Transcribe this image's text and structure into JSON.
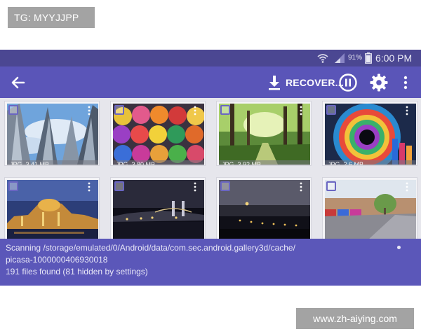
{
  "watermarks": {
    "top": "TG: MYYJJPP",
    "bottom": "www.zh-aiying.com"
  },
  "status_bar": {
    "battery_percent": "91%",
    "time": "6:00 PM"
  },
  "toolbar": {
    "back_icon": "arrow-left-icon",
    "recover_label": "RECOVER...",
    "recover_icon": "download-icon",
    "pause_icon": "pause-circle-icon",
    "settings_icon": "gear-icon",
    "more_icon": "more-vert-icon"
  },
  "photos": [
    {
      "caption": "JPG, 3.41 MB",
      "subject": "skyscrapers"
    },
    {
      "caption": "JPG, 3.80 MB",
      "subject": "yarn"
    },
    {
      "caption": "JPG, 3.92 MB",
      "subject": "forest"
    },
    {
      "caption": "JPG, 2.6 MB",
      "subject": "tunnel"
    },
    {
      "caption": "",
      "subject": "palace-night"
    },
    {
      "caption": "",
      "subject": "bridge-night"
    },
    {
      "caption": "",
      "subject": "harbor-night"
    },
    {
      "caption": "",
      "subject": "street"
    }
  ],
  "scan": {
    "line1": "Scanning /storage/emulated/0/Android/data/com.sec.android.gallery3d/cache/",
    "line2": "picasa-1000000406930018",
    "line3": "191 files found (81 hidden by settings)"
  },
  "colors": {
    "status_bar": "#4b4792",
    "toolbar": "#5a55b8",
    "scan_panel": "#5b57b9",
    "checkbox_border": "#6a66c2"
  }
}
